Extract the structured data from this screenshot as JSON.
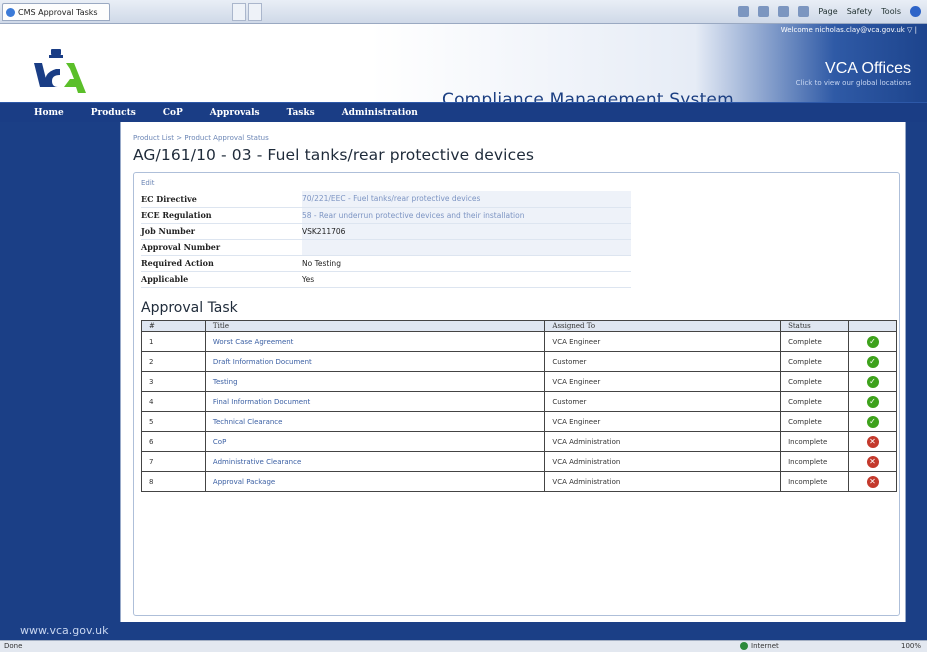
{
  "browser": {
    "tab_title": "CMS Approval Tasks",
    "toolbar": [
      "Page",
      "Safety",
      "Tools"
    ]
  },
  "header": {
    "welcome": "Welcome nicholas.clay@vca.gov.uk ▽ |",
    "logo_text": "VCA",
    "app_title": "Compliance Management System",
    "offices_title": "VCA Offices",
    "offices_sub": "Click to view our global locations"
  },
  "nav": [
    "Home",
    "Products",
    "CoP",
    "Approvals",
    "Tasks",
    "Administration"
  ],
  "breadcrumb": [
    "Product List",
    "Product Approval Status"
  ],
  "page_title": "AG/161/10 - 03 - Fuel tanks/rear protective devices",
  "edit_label": "Edit",
  "details": [
    {
      "label": "EC Directive",
      "value": "70/221/EEC - Fuel tanks/rear protective devices"
    },
    {
      "label": "ECE Regulation",
      "value": "58 - Rear underrun protective devices and their installation"
    },
    {
      "label": "Job Number",
      "value": "VSK211706"
    },
    {
      "label": "Approval Number",
      "value": ""
    },
    {
      "label": "Required Action",
      "value": "No Testing"
    },
    {
      "label": "Applicable",
      "value": "Yes"
    }
  ],
  "section_title": "Approval Task",
  "task_headers": [
    "#",
    "Title",
    "Assigned To",
    "Status",
    ""
  ],
  "tasks": [
    {
      "num": "1",
      "title": "Worst Case Agreement",
      "assigned": "VCA Engineer",
      "status": "Complete",
      "state": "ok"
    },
    {
      "num": "2",
      "title": "Draft Information Document",
      "assigned": "Customer",
      "status": "Complete",
      "state": "ok"
    },
    {
      "num": "3",
      "title": "Testing",
      "assigned": "VCA Engineer",
      "status": "Complete",
      "state": "ok"
    },
    {
      "num": "4",
      "title": "Final Information Document",
      "assigned": "Customer",
      "status": "Complete",
      "state": "ok"
    },
    {
      "num": "5",
      "title": "Technical Clearance",
      "assigned": "VCA Engineer",
      "status": "Complete",
      "state": "ok"
    },
    {
      "num": "6",
      "title": "CoP",
      "assigned": "VCA Administration",
      "status": "Incomplete",
      "state": "bad"
    },
    {
      "num": "7",
      "title": "Administrative Clearance",
      "assigned": "VCA Administration",
      "status": "Incomplete",
      "state": "bad"
    },
    {
      "num": "8",
      "title": "Approval Package",
      "assigned": "VCA Administration",
      "status": "Incomplete",
      "state": "bad"
    }
  ],
  "footer_url": "www.vca.gov.uk",
  "statusbar": {
    "left": "Done",
    "zone": "Internet",
    "zoom": "100%"
  },
  "colors": {
    "nav": "#1a3d85",
    "complete": "#3ea21c",
    "incomplete": "#c43a2d"
  }
}
